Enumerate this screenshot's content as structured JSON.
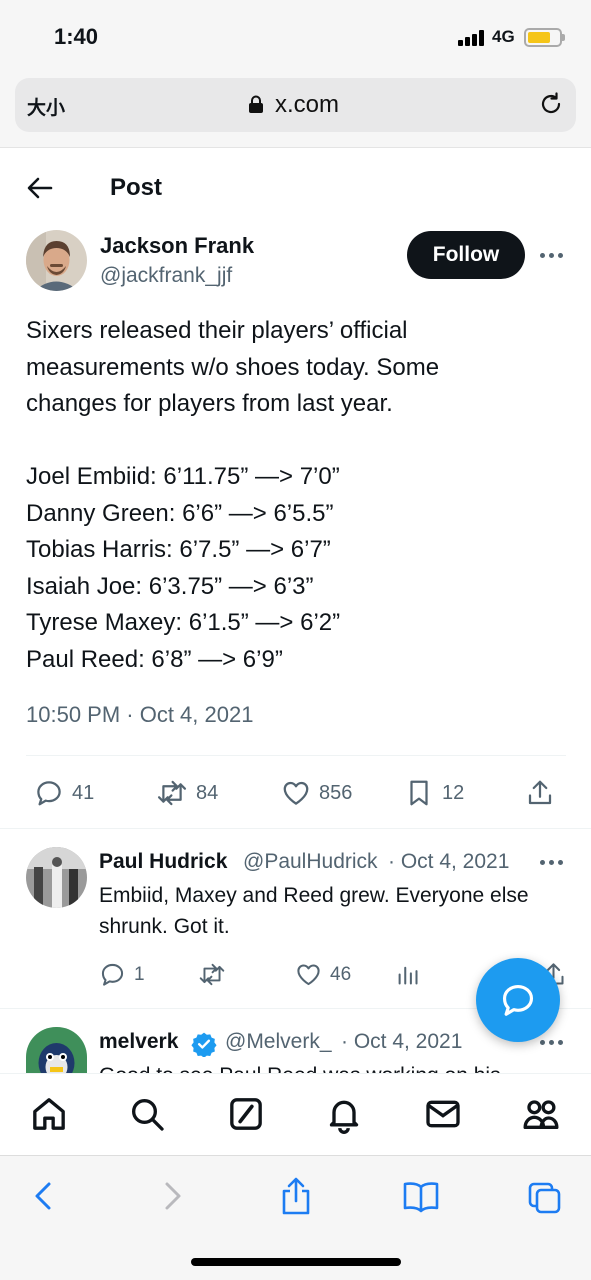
{
  "status_bar": {
    "time": "1:40",
    "network": "4G"
  },
  "browser": {
    "text_size_label": "大小",
    "url": "x.com"
  },
  "header": {
    "title": "Post"
  },
  "post": {
    "author_name": "Jackson Frank",
    "author_handle": "@jackfrank_jjf",
    "follow_label": "Follow",
    "body_lines": [
      "Sixers released their players’ official",
      "measurements w/o shoes today. Some",
      "changes for players from last year.",
      "",
      "Joel Embiid: 6’11.75” —> 7’0”",
      "Danny Green: 6’6” —> 6’5.5”",
      "Tobias Harris: 6’7.5” —> 6’7”",
      "Isaiah Joe: 6’3.75” —> 6’3”",
      "Tyrese Maxey: 6’1.5” —> 6’2”",
      "Paul Reed: 6’8” —> 6’9”"
    ],
    "timestamp": "10:50 PM · Oct 4, 2021",
    "stats": {
      "replies": "41",
      "reposts": "84",
      "likes": "856",
      "bookmarks": "12"
    }
  },
  "replies": [
    {
      "name": "Paul Hudrick",
      "meta": "@PaulHudrick · Oct 4, 2021",
      "date": "· Oct 4, 2021",
      "handle": "@PaulHudrick",
      "text_lines": [
        "Embiid, Maxey and Reed grew. Everyone else",
        "shrunk. Got it."
      ],
      "stats": {
        "replies": "1",
        "reposts": "",
        "likes": "46"
      }
    },
    {
      "name": "melverk",
      "handle": "@Melverk_",
      "date": "· Oct 4, 2021",
      "text_partial": "Good to see Paul Reed was working on his"
    }
  ],
  "tab_bar": [
    "home-tab",
    "search-tab",
    "grok-tab",
    "notifications-tab",
    "messages-tab",
    "communities-tab"
  ],
  "colors": {
    "accent": "#1d9bf0",
    "text": "#0f1419",
    "muted": "#536471",
    "verified": "#1d9bf0"
  }
}
